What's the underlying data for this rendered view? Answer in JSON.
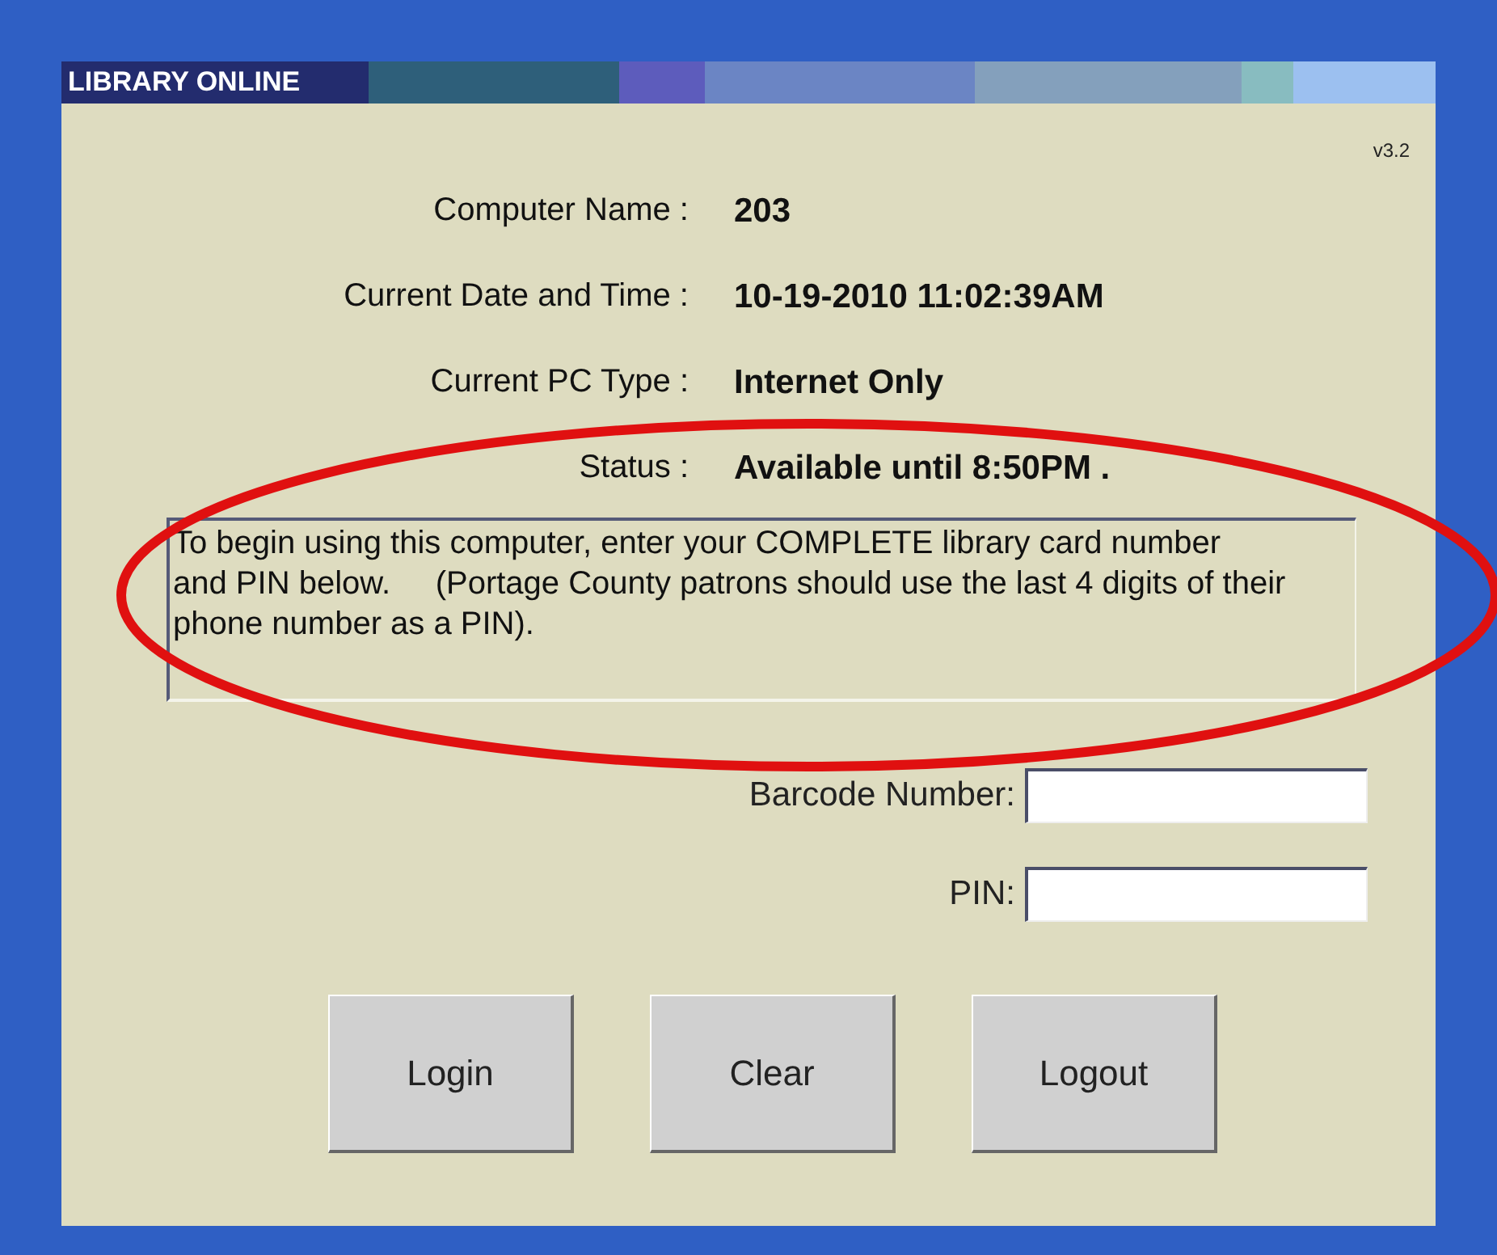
{
  "window": {
    "title": "LIBRARY ONLINE",
    "version": "v3.2"
  },
  "info": [
    {
      "label": "Computer Name :",
      "value": "203"
    },
    {
      "label": "Current Date and Time :",
      "value": "10-19-2010 11:02:39AM"
    },
    {
      "label": "Current PC Type :",
      "value": "Internet Only"
    },
    {
      "label": "Status :",
      "value": "Available until 8:50PM ."
    }
  ],
  "notice": "To begin using this computer, enter your COMPLETE library card number\nand PIN below.     (Portage County patrons should use the last 4 digits of their\nphone number as a PIN).",
  "fields": [
    {
      "label": "Barcode Number:"
    },
    {
      "label": "PIN:"
    }
  ],
  "buttons": [
    "Login",
    "Clear",
    "Logout"
  ],
  "annotation": {
    "kind": "ellipse",
    "color": "#e01010"
  }
}
